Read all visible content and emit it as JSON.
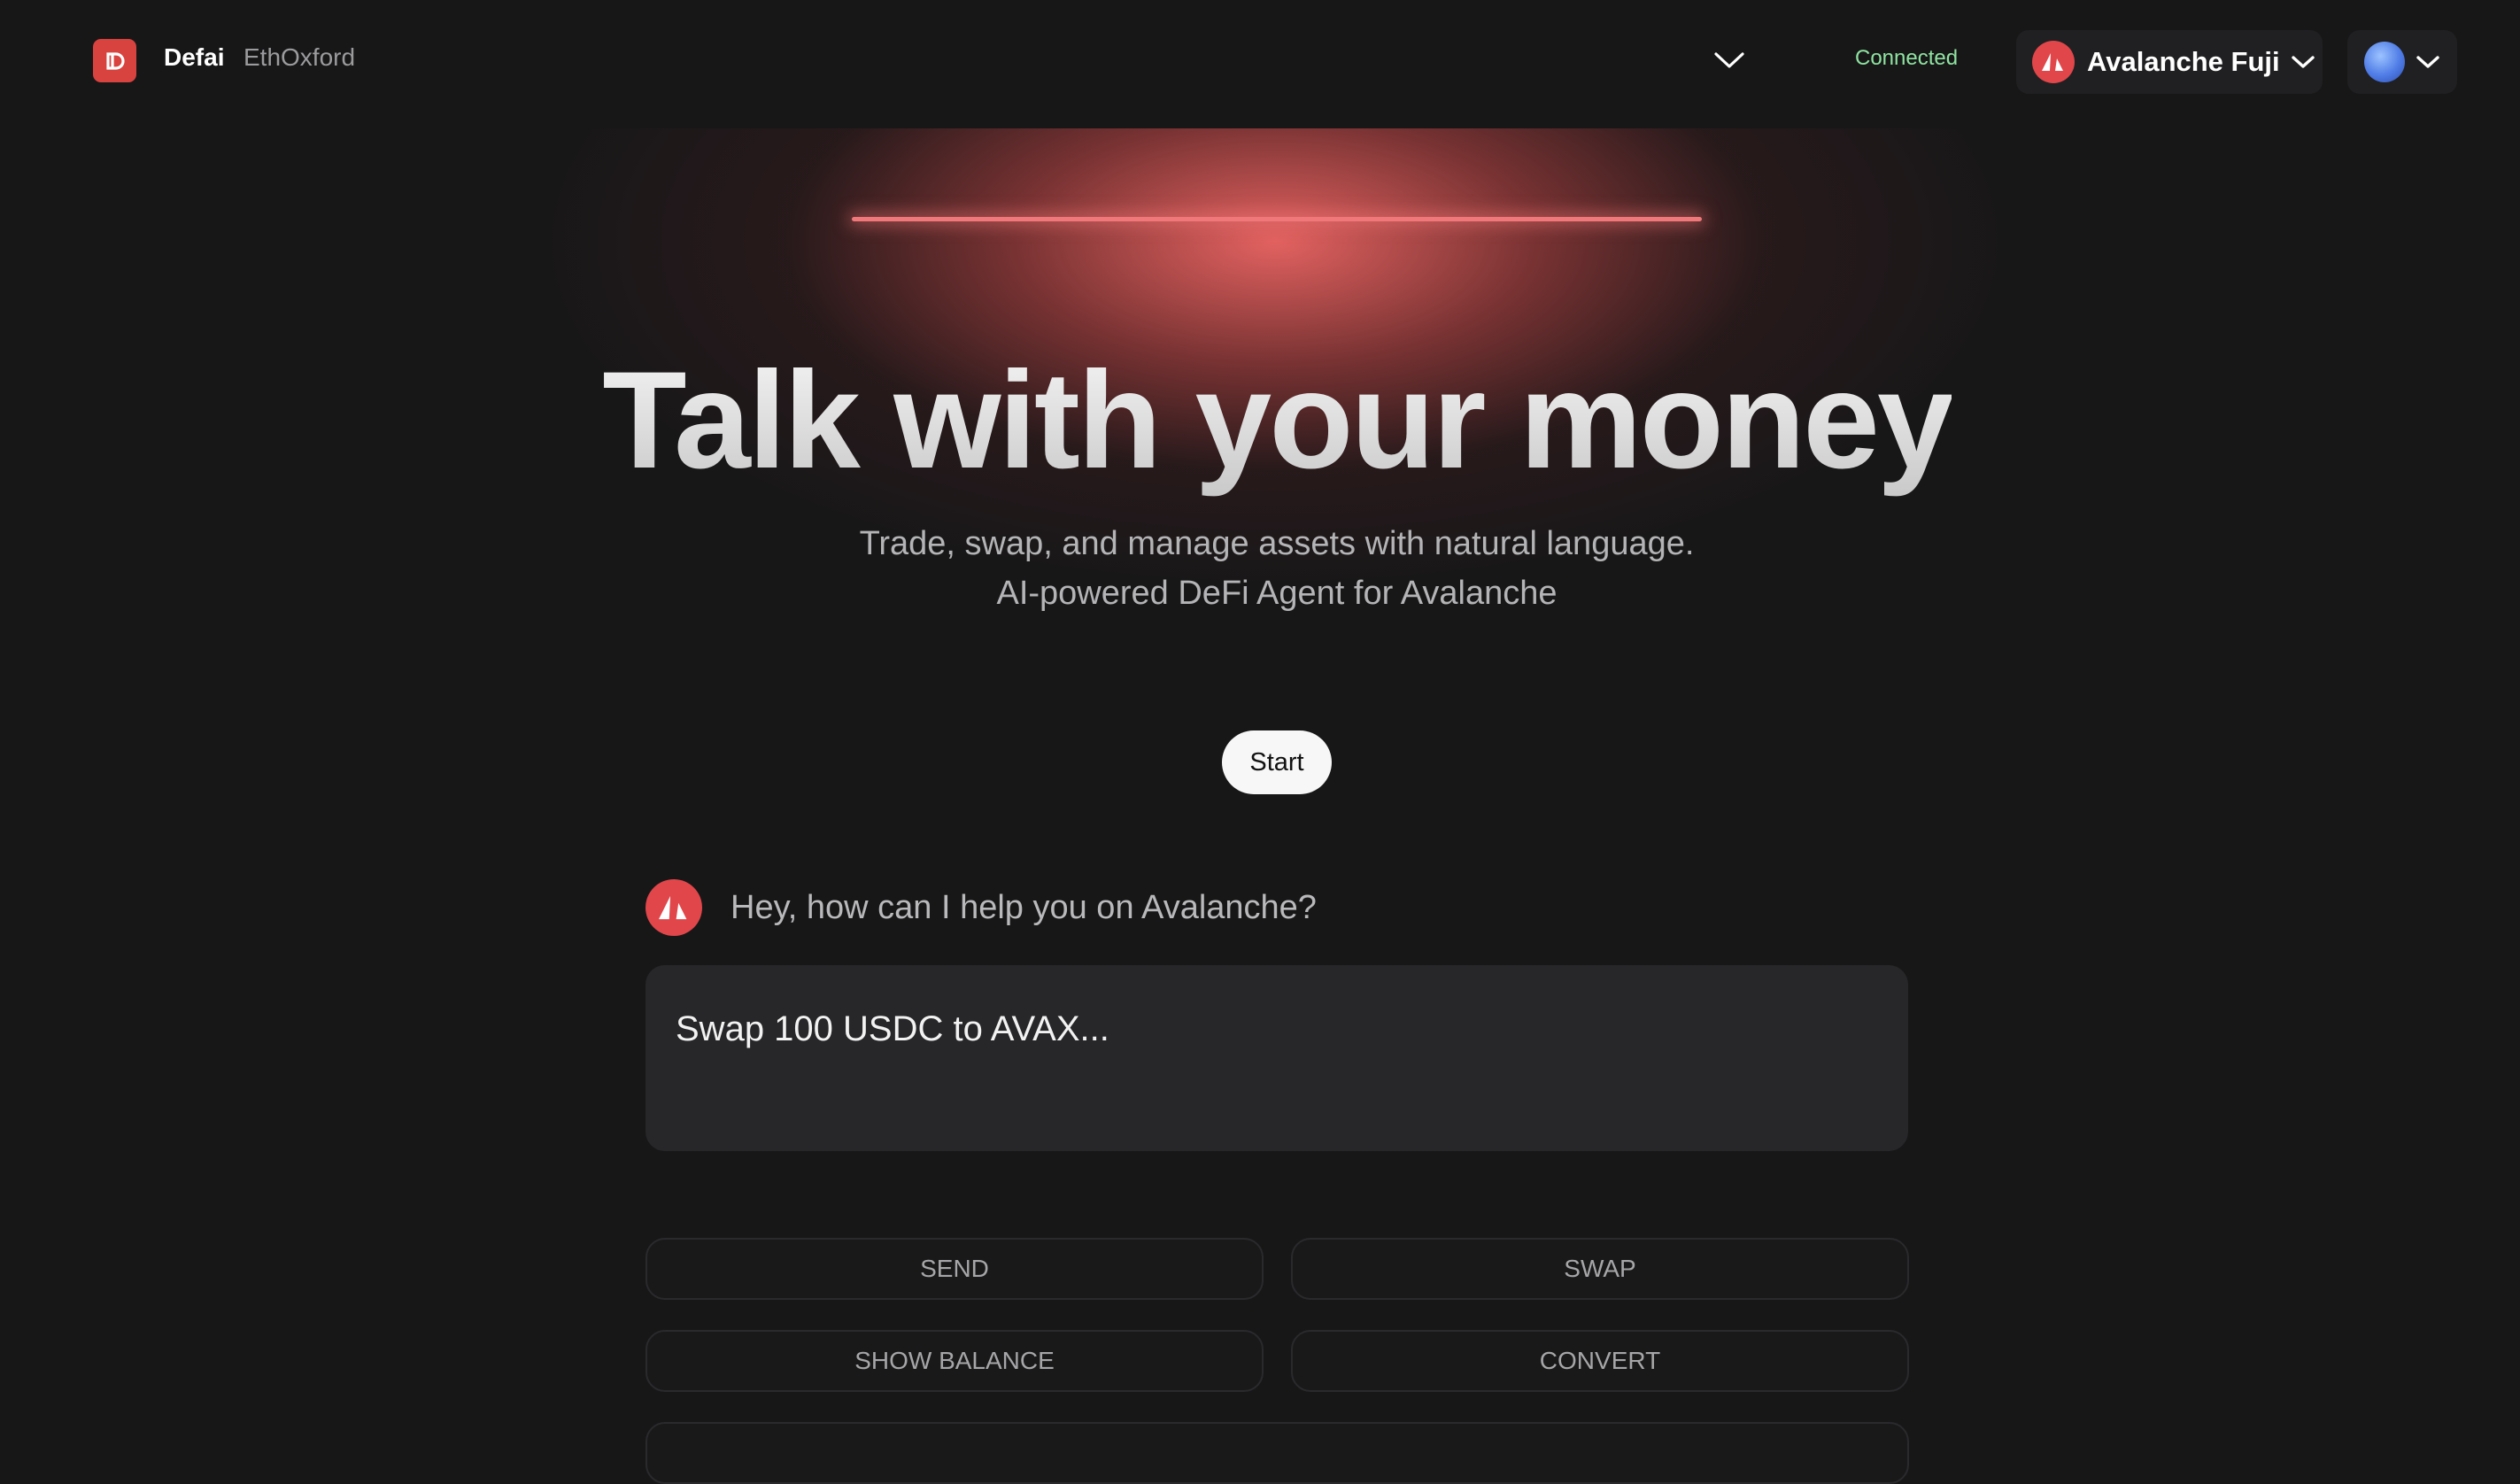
{
  "header": {
    "brand": "Defai",
    "brand_sub": "EthOxford",
    "status": "Connected",
    "network": "Avalanche Fuji",
    "logo_icon": "defai-logo-icon",
    "network_icon": "avalanche-logo-icon",
    "account_icon": "globe-avatar-icon"
  },
  "hero": {
    "title": "Talk with your money",
    "subtitle_line1": "Trade, swap, and manage assets with natural language.",
    "subtitle_line2": "AI-powered DeFi Agent for Avalanche",
    "start_label": "Start"
  },
  "chat": {
    "greeting": "Hey, how can I help you on Avalanche?",
    "placeholder": "Swap 100 USDC to AVAX..."
  },
  "actions": {
    "send": "SEND",
    "swap": "SWAP",
    "show_balance": "SHOW BALANCE",
    "convert": "CONVERT"
  },
  "colors": {
    "background": "#171718",
    "accent": "#e0464a",
    "status": "#8fe3a0",
    "panel": "#27272a"
  }
}
